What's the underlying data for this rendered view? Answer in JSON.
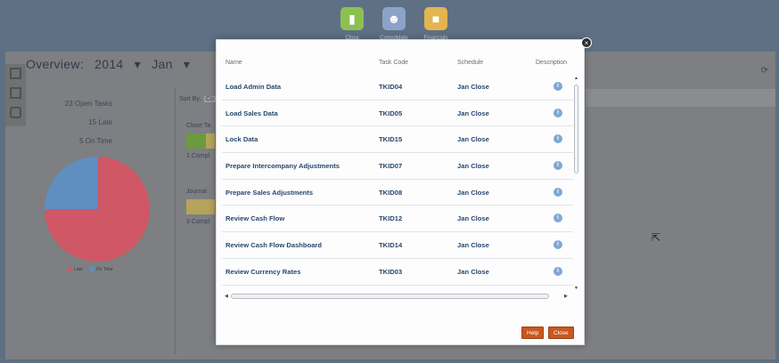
{
  "launcher": {
    "items": [
      {
        "label": "Close",
        "icon": "document-icon",
        "color": "#8cc152"
      },
      {
        "label": "Consolidate",
        "icon": "people-icon",
        "color": "#8ba3c7"
      },
      {
        "label": "Financials",
        "icon": "briefcase-icon",
        "color": "#e3b44f"
      }
    ]
  },
  "overview": {
    "title": "Overview:",
    "year": "2014",
    "month": "Jan",
    "stats": {
      "open": "23 Open Tasks",
      "late": "15 Late",
      "ontime": "5 On Time"
    },
    "legend": {
      "late": "Late",
      "ontime": "On Time"
    },
    "sort_label": "Sort By:",
    "sort_value": "Co",
    "close_label": "Close Ta",
    "close_count": "1 Compl",
    "journal_label": "Journal",
    "journal_count": "3 Compl"
  },
  "colors": {
    "late": "#cf5766",
    "ontime": "#5f8fbf",
    "accent": "#c8581f",
    "link": "#27476e"
  },
  "modal": {
    "columns": {
      "name": "Name",
      "code": "Task Code",
      "schedule": "Schedule",
      "description": "Description"
    },
    "rows": [
      {
        "name": "Load Admin Data",
        "code": "TKID04",
        "schedule": "Jan Close"
      },
      {
        "name": "Load Sales Data",
        "code": "TKID05",
        "schedule": "Jan Close"
      },
      {
        "name": "Lock Data",
        "code": "TKID15",
        "schedule": "Jan Close"
      },
      {
        "name": "Prepare Intercompany Adjustments",
        "code": "TKID07",
        "schedule": "Jan Close"
      },
      {
        "name": "Prepare Sales Adjustments",
        "code": "TKID08",
        "schedule": "Jan Close"
      },
      {
        "name": "Review Cash Flow",
        "code": "TKID12",
        "schedule": "Jan Close"
      },
      {
        "name": "Review Cash Flow Dashboard",
        "code": "TKID14",
        "schedule": "Jan Close"
      },
      {
        "name": "Review Currency Rates",
        "code": "TKID03",
        "schedule": "Jan Close"
      }
    ],
    "info_glyph": "i",
    "help_label": "Help",
    "close_label": "Close",
    "close_glyph": "×"
  },
  "pie": {
    "late_fraction": 0.75,
    "ontime_fraction": 0.25
  }
}
